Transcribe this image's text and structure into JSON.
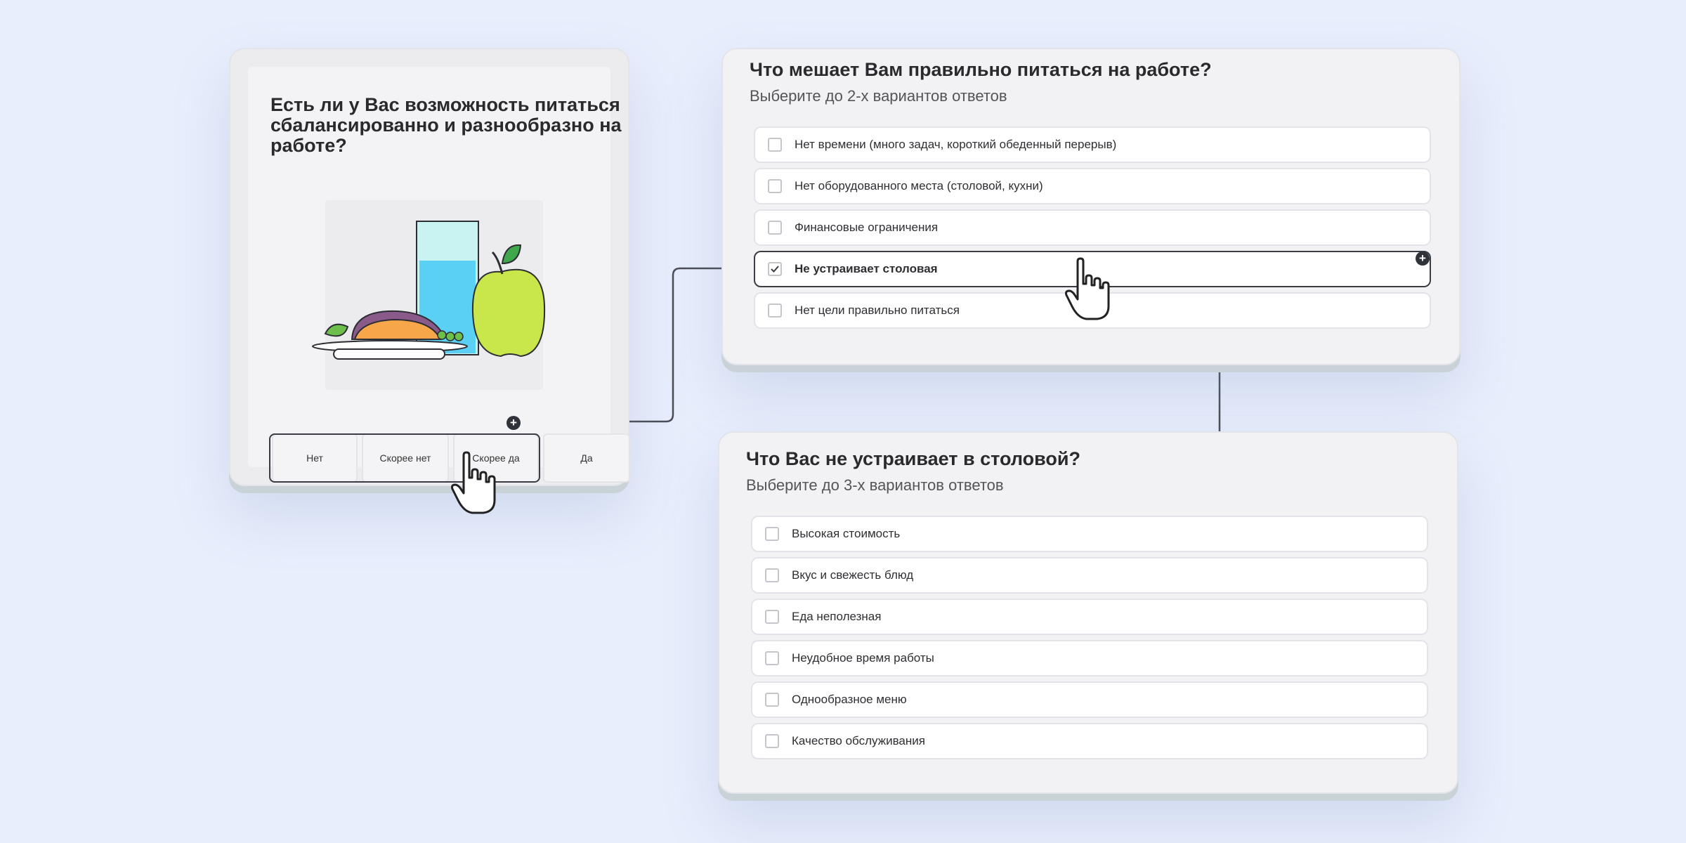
{
  "card1": {
    "question": "Есть ли у Вас возможность питаться сбалансированно и разнообразно на работе?",
    "options": [
      "Нет",
      "Скорее нет",
      "Скорее да",
      "Да"
    ],
    "selected_option": "Скорее да"
  },
  "card2": {
    "question": "Что мешает Вам правильно питаться на работе?",
    "hint": "Выберите до 2-х вариантов ответов",
    "options": [
      {
        "label": "Нет времени (много задач, короткий обеденный перерыв)",
        "checked": false
      },
      {
        "label": "Нет оборудованного места (столовой, кухни)",
        "checked": false
      },
      {
        "label": "Финансовые ограничения",
        "checked": false
      },
      {
        "label": "Не устраивает столовая",
        "checked": true
      },
      {
        "label": "Нет цели правильно питаться",
        "checked": false
      }
    ]
  },
  "card3": {
    "question": "Что Вас не устраивает в столовой?",
    "hint": "Выберите до 3-х вариантов ответов",
    "options": [
      {
        "label": "Высокая стоимость",
        "checked": false
      },
      {
        "label": "Вкус и свежесть блюд",
        "checked": false
      },
      {
        "label": "Еда неполезная",
        "checked": false
      },
      {
        "label": "Неудобное время работы",
        "checked": false
      },
      {
        "label": "Однообразное меню",
        "checked": false
      },
      {
        "label": "Качество обслуживания",
        "checked": false
      }
    ]
  },
  "icons": {
    "branch_connector": "plus-icon",
    "pointer": "hand-pointer-icon",
    "illustration": "food-illustration"
  },
  "colors": {
    "background": "#e8eefc",
    "card": "#f2f2f4",
    "selection_border": "#3a3d44",
    "apple": "#c9e64a",
    "water": "#5ad0f5"
  }
}
